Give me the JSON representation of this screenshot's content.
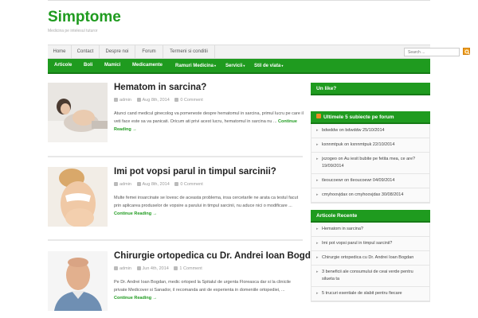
{
  "site": {
    "title": "Simptome",
    "tagline": "Medicina pe intelesul tuturor"
  },
  "top_nav": [
    {
      "label": "Home"
    },
    {
      "label": "Contact"
    },
    {
      "label": "Despre noi"
    },
    {
      "label": "Forum"
    },
    {
      "label": "Termeni si conditii"
    }
  ],
  "search": {
    "placeholder": "Search ..."
  },
  "main_nav": [
    {
      "label": "Articole",
      "has_submenu": false
    },
    {
      "label": "Boli",
      "has_submenu": false
    },
    {
      "label": "Mamici",
      "has_submenu": false
    },
    {
      "label": "Medicamente",
      "has_submenu": false
    },
    {
      "label": "Ramuri Medicina",
      "has_submenu": true,
      "caret": "▾"
    },
    {
      "label": "Servicii",
      "has_submenu": true,
      "caret": "▾"
    },
    {
      "label": "Stil de viata",
      "has_submenu": true,
      "caret": "▾"
    }
  ],
  "articles": [
    {
      "title": "Hematom in sarcina?",
      "author": "admin",
      "date": "Aug 8th, 2014",
      "comments": "0 Comment",
      "excerpt": "Atunci cand medicul ginecolog va pomeneste despre hematomul in sarcina, primul lucru pe care il veti face este sa va panicati. Oricum ati privi acest lucru, hematomul in sarcina nu ...",
      "read_more": "Continue Reading →"
    },
    {
      "title": "Imi pot vopsi parul in timpul sarcinii?",
      "author": "admin",
      "date": "Aug 8th, 2014",
      "comments": "0 Comment",
      "excerpt": "Multe femei insarcinate se lovesc de aceasta problema, insa cercetarile ne arata ca testul facut prin aplicarea produselor de vopsire a parului in timpul sarcinii, nu aduce nici o modificare ...",
      "read_more": "Continue Reading →"
    },
    {
      "title": "Chirurgie ortopedica cu Dr. Andrei Ioan Bogdan",
      "author": "admin",
      "date": "Jun 4th, 2014",
      "comments": "1 Comment",
      "excerpt": "Pe Dr. Andrei Ioan Bogdan, medic ortoped la Spitalul de urgenta Floreasca dar si la clinicile private Medicover si Sanador, il recomanda anii de experienta in domeniile ortopediei, ...",
      "read_more": "Continue Reading →"
    }
  ],
  "widgets": {
    "un_like": {
      "title": "Un like?"
    },
    "forum": {
      "title": "Ultimele 5 subiecte pe forum",
      "items": [
        "bdwddw on bdwddw 25/10/2014",
        "kxnnmtpuk on kxnnmtpuk 22/10/2014",
        "jxzogeo on Au iesit bubite pe fetita mea, ce are? 19/09/2014",
        "tleoucoewr on tleoucoewr 04/09/2014",
        "cmyhoovjdax on cmyhoovjdax 30/08/2014"
      ]
    },
    "recent": {
      "title": "Articole Recente",
      "items": [
        "Hematom in sarcina?",
        "Imi pot vopsi parul in timpul sarcinii?",
        "Chirurgie ortopedica cu Dr. Andrei Ioan Bogdan",
        "3 beneficii ale consumului de ceai verde pentru silueta ta",
        "5 trucuri esentiale de slabit pentru fiecare"
      ]
    }
  },
  "colors": {
    "brand_green": "#1f9b1f",
    "search_button": "#f0a020",
    "rss": "#f08a24"
  }
}
